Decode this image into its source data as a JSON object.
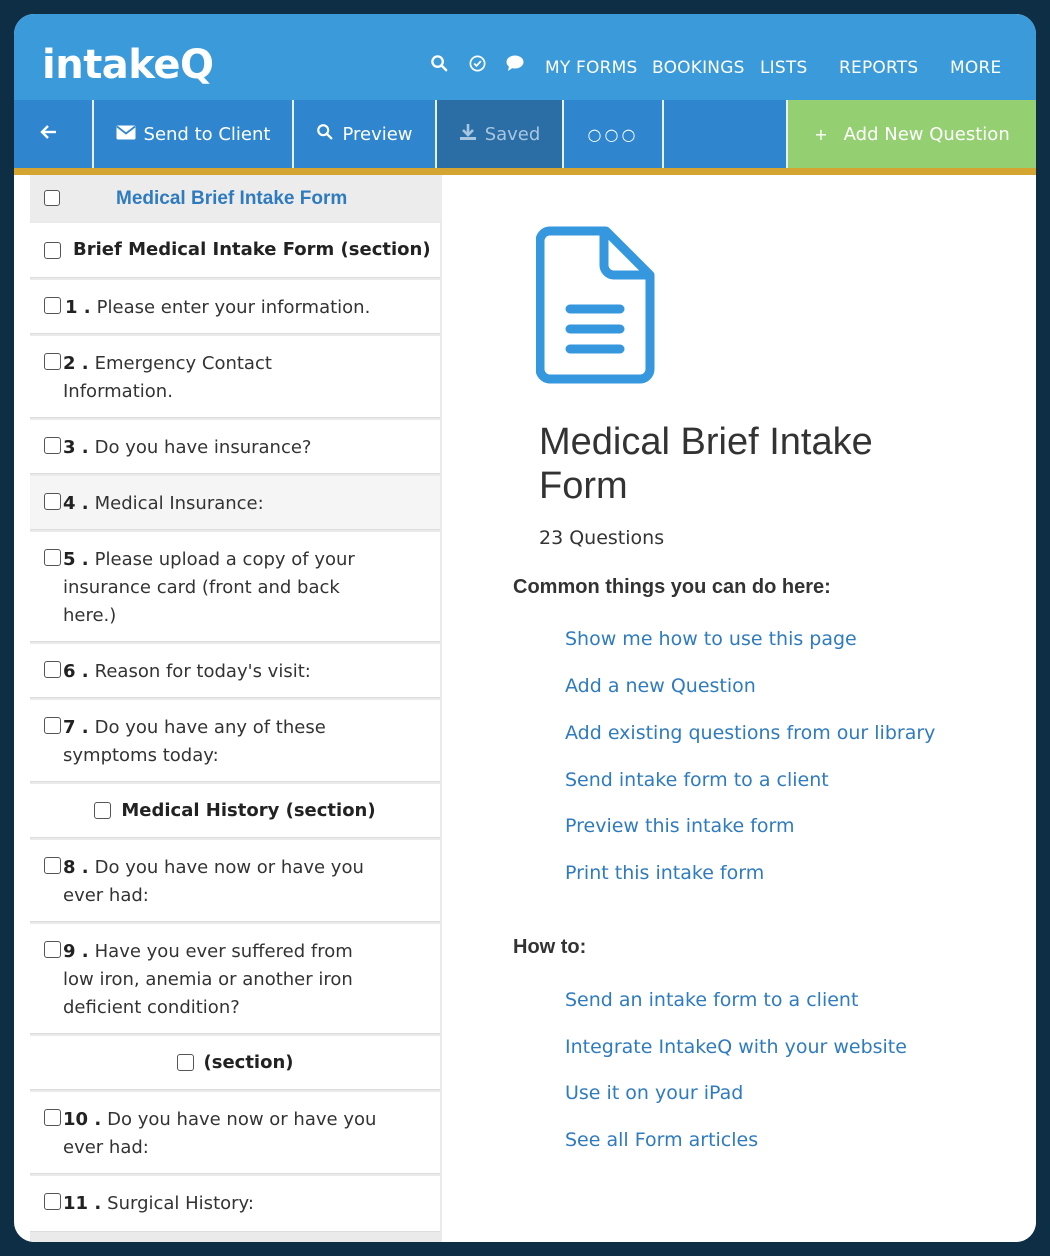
{
  "app": {
    "logo": "intakeQ",
    "nav": {
      "my_forms": "MY FORMS",
      "bookings": "BOOKINGS",
      "lists": "LISTS",
      "reports": "REPORTS",
      "more": "MORE"
    },
    "nav_icons": [
      "search-icon",
      "check-circle-icon",
      "chat-bubble-icon"
    ]
  },
  "toolbar": {
    "back_icon": "arrow-left-icon",
    "send_label": "Send to Client",
    "preview_label": "Preview",
    "saved_label": "Saved",
    "more_label": "○○○",
    "add_label": "Add New Question",
    "add_prefix": "+"
  },
  "sidebar": {
    "header_title": "Medical Brief Intake Form",
    "rows": [
      {
        "type": "section",
        "num": "",
        "text": "Brief Medical Intake Form (section)"
      },
      {
        "type": "question",
        "num": "1 .",
        "text": "Please enter your information."
      },
      {
        "type": "question",
        "num": "2 .",
        "text": "Emergency Contact Information."
      },
      {
        "type": "question",
        "num": "3 .",
        "text": "Do you have insurance?"
      },
      {
        "type": "question",
        "num": "4 .",
        "text": "Medical Insurance:"
      },
      {
        "type": "question",
        "num": "5 .",
        "text": "Please upload a copy of your insurance card (front and back here.)"
      },
      {
        "type": "question",
        "num": "6 .",
        "text": "Reason for today's visit:"
      },
      {
        "type": "question",
        "num": "7 .",
        "text": "Do you have any of these symptoms today:"
      },
      {
        "type": "section",
        "num": "",
        "text": "Medical History (section)"
      },
      {
        "type": "question",
        "num": "8 .",
        "text": "Do you have now or have you ever had:"
      },
      {
        "type": "question",
        "num": "9 .",
        "text": "Have you ever suffered from low iron, anemia or another iron deficient condition?"
      },
      {
        "type": "section",
        "num": "",
        "text": "(section)"
      },
      {
        "type": "question",
        "num": "10 .",
        "text": "Do you have now or have you ever had:"
      },
      {
        "type": "question",
        "num": "11 .",
        "text": "Surgical History:"
      }
    ]
  },
  "main": {
    "form_title": "Medical Brief Intake Form",
    "question_count": "23 Questions",
    "common_heading": "Common things you can do here:",
    "common_links": [
      "Show me how to use this page",
      "Add a new Question",
      "Add existing questions from our library",
      "Send intake form to a client",
      "Preview this intake form",
      "Print this intake form"
    ],
    "howto_heading": "How to:",
    "howto_links": [
      "Send an intake form to a client",
      "Integrate IntakeQ with your website",
      "Use it on your iPad",
      "See all Form articles"
    ]
  },
  "colors": {
    "nav_blue": "#3b9ad9",
    "toolbar_blue": "#2f86cf",
    "add_green": "#94cf72",
    "accent_gold": "#d4a531",
    "link_blue": "#2f7bbf",
    "frame": "#0d2e44"
  }
}
